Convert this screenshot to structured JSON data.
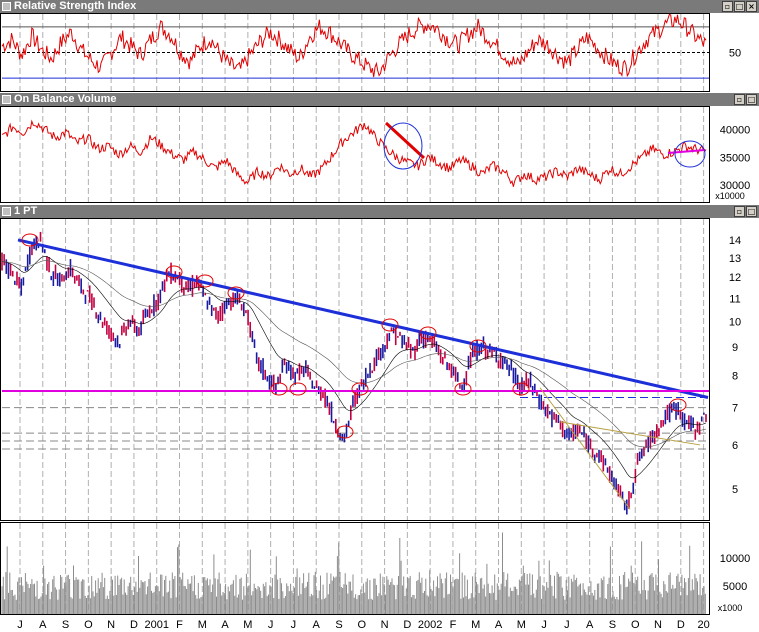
{
  "panels": {
    "rsi": {
      "title": "Relative Strength Index"
    },
    "obv": {
      "title": "On Balance Volume"
    },
    "price": {
      "title": "1 PT"
    }
  },
  "window_buttons": {
    "minimize": "▫",
    "maximize": "□",
    "close": "×"
  },
  "colors": {
    "title_bar": "#7a7a7a",
    "rsi_line": "#e00000",
    "obv_line": "#e00000",
    "trend_line": "#1c2fd8",
    "support_line": "#e000e0",
    "volume_bar": "#8c8c8c",
    "circle_red": "#e00000",
    "circle_blue": "#1c2fd8",
    "up_candle": "#1a1aa0",
    "down_candle": "#c00040"
  },
  "chart_data": [
    {
      "type": "line",
      "panel": "rsi",
      "title": "Relative Strength Index",
      "y_ticks": [
        "50"
      ],
      "ylim": [
        20,
        80
      ],
      "reference_lines": [
        {
          "value": 70,
          "style": "solid"
        },
        {
          "value": 50,
          "style": "dashed"
        },
        {
          "value": 30,
          "style": "solid"
        }
      ],
      "series": [
        {
          "values": [
            55,
            60,
            48,
            63,
            52,
            45,
            58,
            66,
            52,
            44,
            38,
            50,
            62,
            55,
            48,
            60,
            70,
            64,
            50,
            43,
            55,
            61,
            49,
            40,
            36,
            48,
            58,
            66,
            60,
            52,
            45,
            62,
            70,
            66,
            58,
            50,
            44,
            38,
            34,
            46,
            56,
            64,
            70,
            72,
            68,
            60,
            56,
            64,
            70,
            62,
            54,
            46,
            40,
            50,
            60,
            56,
            48,
            42,
            52,
            62,
            54,
            46,
            40,
            38,
            50,
            60,
            66,
            72,
            76,
            70,
            62,
            56
          ]
        }
      ]
    },
    {
      "type": "line",
      "panel": "obv",
      "title": "On Balance Volume",
      "y_ticks": [
        "40000",
        "35000",
        "30000"
      ],
      "y_unit": "x10000",
      "ylim": [
        27000,
        44000
      ],
      "series": [
        {
          "values": [
            38500,
            40500,
            39500,
            41500,
            40000,
            38500,
            39500,
            37500,
            38500,
            36500,
            37000,
            35500,
            37000,
            36000,
            38500,
            37000,
            35500,
            34500,
            36000,
            34500,
            33000,
            34500,
            32000,
            30500,
            32500,
            31500,
            33500,
            32000,
            33000,
            31500,
            33000,
            35500,
            38000,
            39500,
            41000,
            38500,
            36500,
            35000,
            34000,
            33500,
            35000,
            34000,
            33000,
            34500,
            33500,
            32000,
            33500,
            32500,
            30500,
            32000,
            31000,
            31500,
            32500,
            31500,
            33000,
            32000,
            31000,
            33000,
            32000,
            33500,
            35000,
            36500,
            35500,
            36000,
            37000,
            36500,
            36000
          ]
        }
      ]
    },
    {
      "type": "candlestick",
      "panel": "price",
      "title": "1 PT",
      "y_ticks": [
        "14",
        "13",
        "12",
        "11",
        "10",
        "9",
        "8",
        "7",
        "6",
        "5"
      ],
      "ylim": [
        4.4,
        15.2
      ],
      "y_scale": "log",
      "x_tick_labels": [
        "J",
        "A",
        "S",
        "O",
        "N",
        "D",
        "2001",
        "F",
        "M",
        "A",
        "M",
        "J",
        "J",
        "A",
        "S",
        "O",
        "N",
        "D",
        "2002",
        "F",
        "M",
        "A",
        "M",
        "J",
        "J",
        "A",
        "S",
        "O",
        "N",
        "D",
        "20"
      ],
      "series": [
        {
          "name": "close",
          "values": [
            12.8,
            12.2,
            11.4,
            13.6,
            14.0,
            12.2,
            11.8,
            12.4,
            11.6,
            11.0,
            10.2,
            9.6,
            9.2,
            10.0,
            9.6,
            10.4,
            11.0,
            12.2,
            12.0,
            11.4,
            11.8,
            10.8,
            10.2,
            10.8,
            11.0,
            10.4,
            8.6,
            8.0,
            7.6,
            8.4,
            8.0,
            8.2,
            7.6,
            7.4,
            6.6,
            6.1,
            7.2,
            7.8,
            8.4,
            9.0,
            9.6,
            9.2,
            8.8,
            9.4,
            9.2,
            8.6,
            8.2,
            7.6,
            8.6,
            9.0,
            8.8,
            8.6,
            8.2,
            7.6,
            7.8,
            7.2,
            6.8,
            6.6,
            6.2,
            6.4,
            6.0,
            5.8,
            5.4,
            5.0,
            4.6,
            5.6,
            6.0,
            6.4,
            6.8,
            7.0,
            6.6,
            6.4,
            6.8
          ]
        }
      ],
      "trend_line": {
        "from": {
          "x": "Jul 2000",
          "y": 14.0
        },
        "to": {
          "x": "Jan 2003",
          "y": 7.3
        }
      },
      "support_line": {
        "y": 7.5
      },
      "dashed_levels": [
        7.0,
        6.3,
        6.1,
        5.9
      ]
    },
    {
      "type": "bar",
      "panel": "volume",
      "y_ticks": [
        "10000",
        "5000"
      ],
      "y_unit": "x1000",
      "ylim": [
        0,
        16000
      ]
    }
  ]
}
